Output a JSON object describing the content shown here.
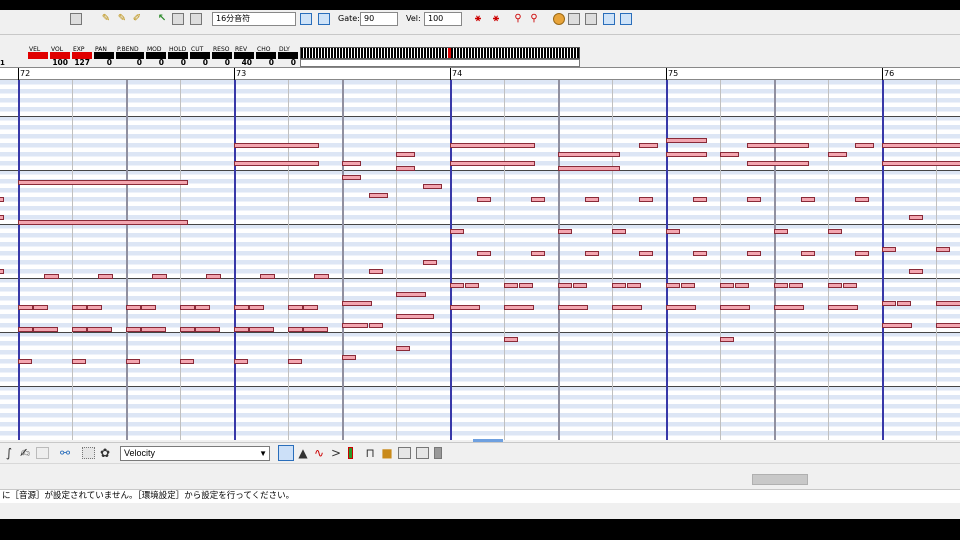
{
  "toolbar": {
    "quantize_value": "16分音符",
    "gate_label": "Gate:",
    "gate_value": "90",
    "vel_label": "Vel:",
    "vel_value": "100"
  },
  "controllers": [
    {
      "label": "VEL",
      "value": "",
      "color": "#e00000"
    },
    {
      "label": "VOL",
      "value": "100",
      "color": "#e00000"
    },
    {
      "label": "EXP",
      "value": "127",
      "color": "#e00000"
    },
    {
      "label": "PAN",
      "value": "0",
      "color": "#000000"
    },
    {
      "label": "P.BEND",
      "value": "0",
      "color": "#000000"
    },
    {
      "label": "MOD",
      "value": "0",
      "color": "#000000"
    },
    {
      "label": "HOLD",
      "value": "0",
      "color": "#000000"
    },
    {
      "label": "CUT",
      "value": "0",
      "color": "#000000"
    },
    {
      "label": "RESO",
      "value": "0",
      "color": "#000000"
    },
    {
      "label": "REV",
      "value": "40",
      "color": "#000000"
    },
    {
      "label": "CHO",
      "value": "0",
      "color": "#000000"
    },
    {
      "label": "DLY",
      "value": "0",
      "color": "#000000"
    }
  ],
  "channel_value": "1",
  "ruler": {
    "measures": [
      "72",
      "73",
      "74",
      "75",
      "76"
    ]
  },
  "bottom_toolbar": {
    "lane_select": "Velocity"
  },
  "status": {
    "message": "に［音源］が設定されていません。［環境設定］から設定を行ってください。"
  },
  "colors": {
    "note_fill": "#f3a6b0",
    "note_border": "#8a2a38",
    "measure_line": "#3838a8",
    "meter_red": "#e00000"
  }
}
